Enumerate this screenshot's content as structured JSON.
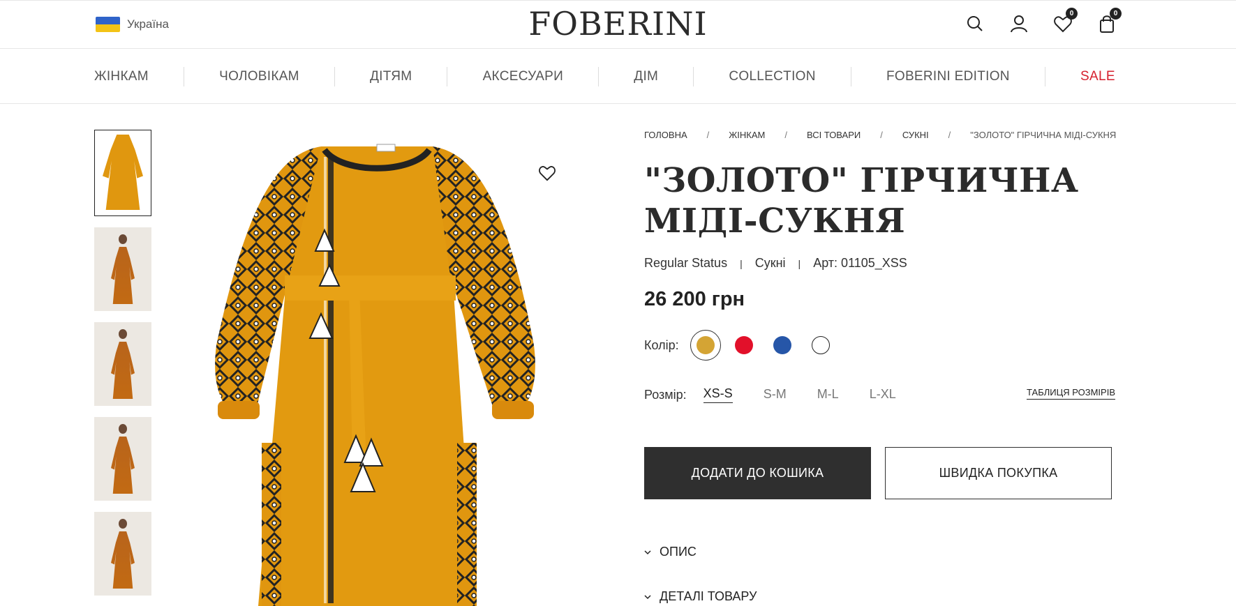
{
  "header": {
    "locale": "Україна",
    "logo": "FOBERINI",
    "wishlist_count": "0",
    "cart_count": "0"
  },
  "nav": {
    "items": [
      {
        "label": "ЖІНКАМ"
      },
      {
        "label": "ЧОЛОВІКАМ"
      },
      {
        "label": "ДІТЯМ"
      },
      {
        "label": "АКСЕСУАРИ"
      },
      {
        "label": "ДІМ"
      },
      {
        "label": "COLLECTION"
      },
      {
        "label": "FOBERINI EDITION"
      },
      {
        "label": "SALE"
      }
    ]
  },
  "breadcrumb": {
    "items": [
      "ГОЛОВНА",
      "ЖІНКАМ",
      "ВСІ ТОВАРИ",
      "СУКНІ",
      "\"ЗОЛОТО\" ГІРЧИЧНА МІДІ-СУКНЯ"
    ]
  },
  "product": {
    "title": "\"ЗОЛОТО\" ГІРЧИЧНА МІДІ-СУКНЯ",
    "status": "Regular Status",
    "category": "Сукні",
    "sku": "Арт: 01105_XSS",
    "price": "26 200 грн",
    "color_label": "Колір:",
    "colors": [
      "#d4a434",
      "#e2102a",
      "#2656a8",
      "#ffffff"
    ],
    "size_label": "Розмір:",
    "sizes": [
      "XS-S",
      "S-M",
      "M-L",
      "L-XL"
    ],
    "size_table": "ТАБЛИЦЯ РОЗМІРІВ",
    "add_to_cart": "ДОДАТИ ДО КОШИКА",
    "quick_buy": "ШВИДКА ПОКУПКА",
    "sections": [
      "ОПИС",
      "ДЕТАЛІ ТОВАРУ"
    ]
  },
  "icons": [
    "search-icon",
    "user-icon",
    "heart-icon",
    "bag-icon",
    "chevron-down-icon"
  ]
}
